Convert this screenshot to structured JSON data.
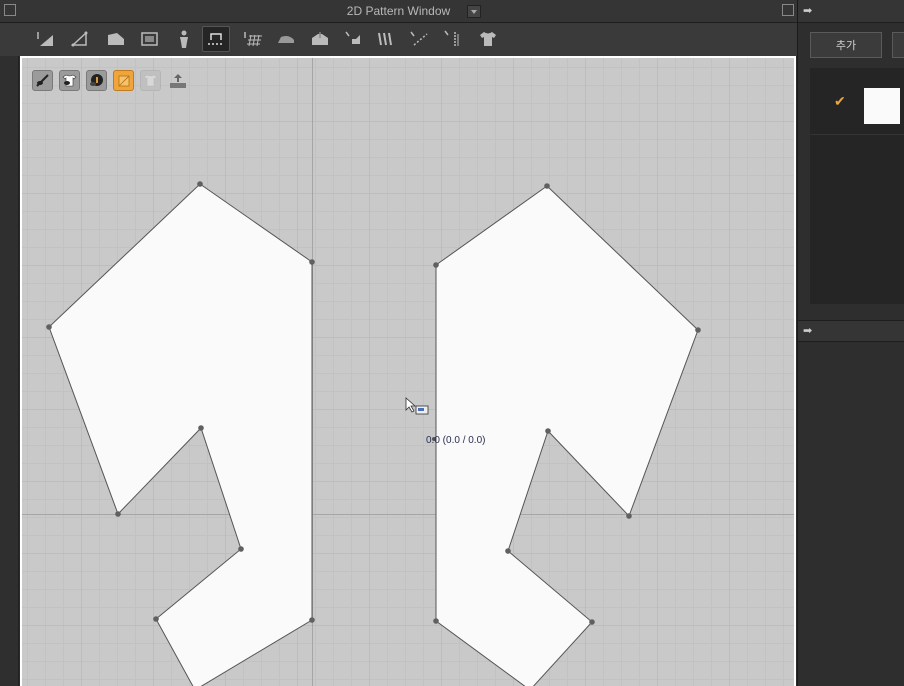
{
  "window": {
    "title": "2D Pattern Window"
  },
  "toolbar": {
    "tools": [
      {
        "name": "edit-pattern-tool",
        "icon": "pointer-triangle-icon"
      },
      {
        "name": "transform-pattern-tool",
        "icon": "transform-triangle-icon"
      },
      {
        "name": "edit-point-line-tool",
        "icon": "polygon-fill-icon"
      },
      {
        "name": "rectangle-tool",
        "icon": "rectangle-icon"
      },
      {
        "name": "avatar-tool",
        "icon": "avatar-figure-icon"
      },
      {
        "name": "segment-sewing-tool",
        "icon": "sewing-segment-icon",
        "active": true
      },
      {
        "name": "grid-tool",
        "icon": "grid-icon"
      },
      {
        "name": "iron-tool",
        "icon": "iron-icon"
      },
      {
        "name": "fold-tool",
        "icon": "fold-icon"
      },
      {
        "name": "pin-tool",
        "icon": "pin-icon"
      },
      {
        "name": "pleat-tool",
        "icon": "pleat-icon"
      },
      {
        "name": "measure-tool",
        "icon": "measure-line-icon"
      },
      {
        "name": "ruler-tool",
        "icon": "ruler-icon"
      },
      {
        "name": "garment-tool",
        "icon": "tshirt-icon"
      }
    ]
  },
  "canvas": {
    "mini_tools": [
      {
        "name": "show-sewing-line-toggle",
        "icon": "eye-needle-icon"
      },
      {
        "name": "show-garment-toggle",
        "icon": "eye-shirt-icon"
      },
      {
        "name": "show-info-toggle",
        "icon": "eye-info-icon"
      },
      {
        "name": "show-texture-toggle",
        "icon": "texture-orange-icon",
        "active": true
      },
      {
        "name": "show-fabric-toggle",
        "icon": "fabric-faded-icon",
        "faded": true
      },
      {
        "name": "export-toggle",
        "icon": "export-tray-icon"
      }
    ],
    "cursor_readout": "0.0 (0.0 / 0.0)"
  },
  "right_panel": {
    "add_button_label": "추가"
  },
  "colors": {
    "panel_bg": "#2b2b2b",
    "canvas_bg": "#c9c9c9",
    "pattern_fill": "#fafafa",
    "accent": "#f0a53b"
  }
}
